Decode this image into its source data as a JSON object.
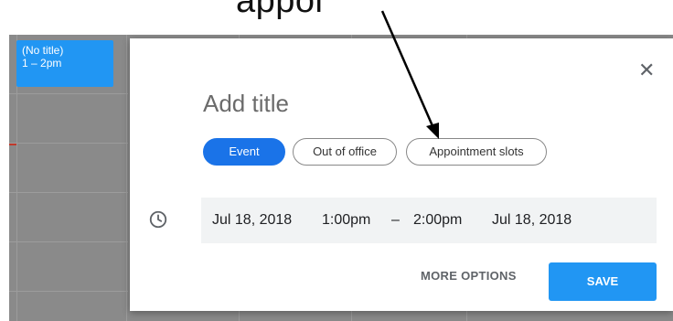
{
  "caption": {
    "text": "appoi"
  },
  "calendar": {
    "event_chip": {
      "title": "(No title)",
      "time": "1 – 2pm"
    }
  },
  "dialog": {
    "close_glyph": "✕",
    "title_placeholder": "Add title",
    "chips": [
      {
        "label": "Event"
      },
      {
        "label": "Out of office"
      },
      {
        "label": "Appointment slots"
      }
    ],
    "time": {
      "start_date": "Jul 18, 2018",
      "start_time": "1:00pm",
      "separator": "–",
      "end_time": "2:00pm",
      "end_date": "Jul 18, 2018"
    },
    "buttons": {
      "more": "MORE OPTIONS",
      "save": "SAVE"
    }
  },
  "colors": {
    "primary": "#2196f3",
    "event_chip_active": "#1a73e8",
    "calendar_bg": "#8a8a8a"
  }
}
